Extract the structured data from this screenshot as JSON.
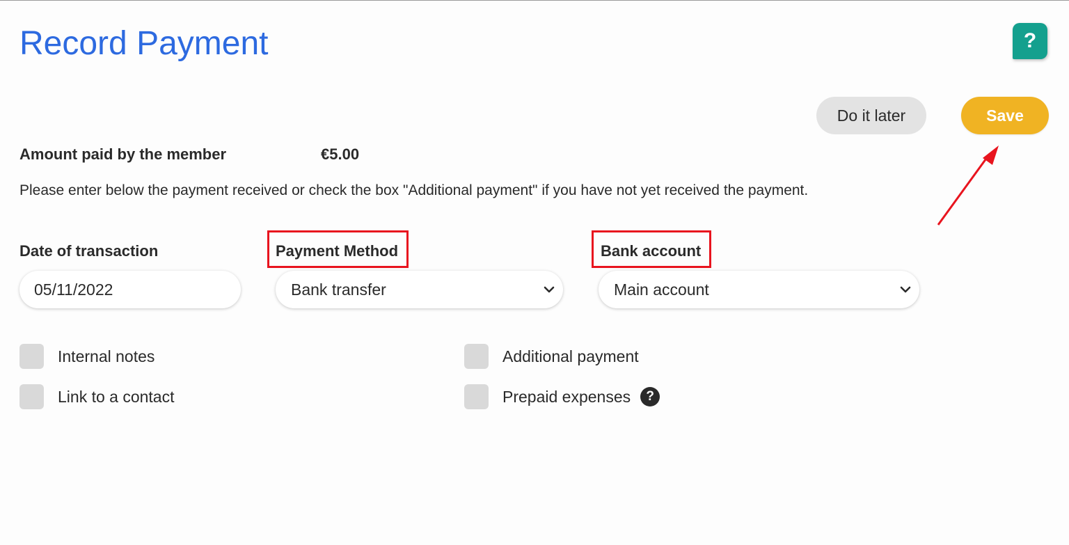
{
  "header": {
    "title": "Record Payment",
    "help_symbol": "?"
  },
  "actions": {
    "later_label": "Do it later",
    "save_label": "Save"
  },
  "amount": {
    "label": "Amount paid by the member",
    "value": "€5.00"
  },
  "instructions": "Please enter below the payment received or check the box \"Additional payment\" if you have not yet received the payment.",
  "fields": {
    "date": {
      "label": "Date of transaction",
      "value": "05/11/2022"
    },
    "payment_method": {
      "label": "Payment Method",
      "value": "Bank transfer"
    },
    "bank_account": {
      "label": "Bank account",
      "value": "Main account"
    }
  },
  "checkboxes": {
    "internal_notes": "Internal notes",
    "link_contact": "Link to a contact",
    "additional_payment": "Additional payment",
    "prepaid_expenses": "Prepaid expenses",
    "info_symbol": "?"
  },
  "colors": {
    "title": "#2d6ae0",
    "help_button": "#14a08e",
    "save_button": "#f0b323",
    "later_button": "#e3e3e3",
    "highlight": "#e8141e"
  }
}
